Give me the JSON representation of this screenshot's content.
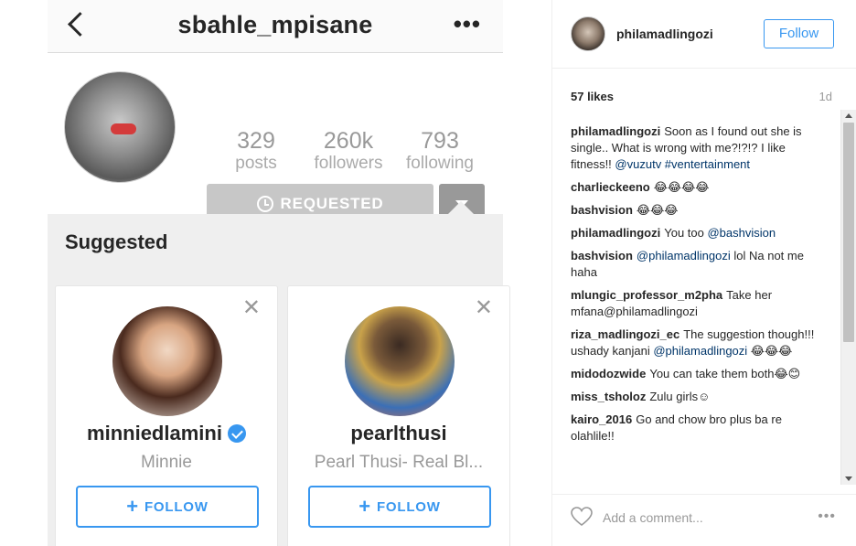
{
  "phone": {
    "username": "sbahle_mpisane",
    "stats": [
      {
        "num": "329",
        "label": "posts"
      },
      {
        "num": "260k",
        "label": "followers"
      },
      {
        "num": "793",
        "label": "following"
      }
    ],
    "requested_label": "REQUESTED",
    "suggested_title": "Suggested",
    "cards": [
      {
        "name": "minniedlamini",
        "sub": "Minnie",
        "verified": true,
        "follow_label": "FOLLOW",
        "close": "✕"
      },
      {
        "name": "pearlthusi",
        "sub": "Pearl Thusi- Real Bl...",
        "verified": false,
        "follow_label": "FOLLOW",
        "close": "✕"
      }
    ]
  },
  "post": {
    "author": "philamadlingozi",
    "follow_label": "Follow",
    "likes": "57 likes",
    "time": "1d",
    "comments": [
      {
        "user": "philamadlingozi",
        "text": "Soon as I found out she is single.. What is wrong with me?!?!? I like fitness!!",
        "link": "@vuzutv #ventertainment"
      },
      {
        "user": "charlieckeeno",
        "text": "😂😂😂😂",
        "link": ""
      },
      {
        "user": "bashvision",
        "text": "😂😂😂",
        "link": ""
      },
      {
        "user": "philamadlingozi",
        "text": "You too",
        "link": "@bashvision"
      },
      {
        "user": "bashvision",
        "text": "",
        "link": "@philamadlingozi",
        "after": "lol Na not me haha"
      },
      {
        "user": "mlungic_professor_m2pha",
        "text": "Take her mfana@philamadlingozi",
        "link": ""
      },
      {
        "user": "riza_madlingozi_ec",
        "text": "The suggestion though!!! ushady kanjani",
        "link": "@philamadlingozi",
        "after": "😂😂😂"
      },
      {
        "user": "midodozwide",
        "text": "You can take them both😂😊",
        "link": ""
      },
      {
        "user": "miss_tsholoz",
        "text": "Zulu girls☺",
        "link": ""
      },
      {
        "user": "kairo_2016",
        "text": "Go and chow bro plus ba re olahlile!!",
        "link": ""
      }
    ],
    "comment_placeholder": "Add a comment...",
    "more": "•••"
  }
}
